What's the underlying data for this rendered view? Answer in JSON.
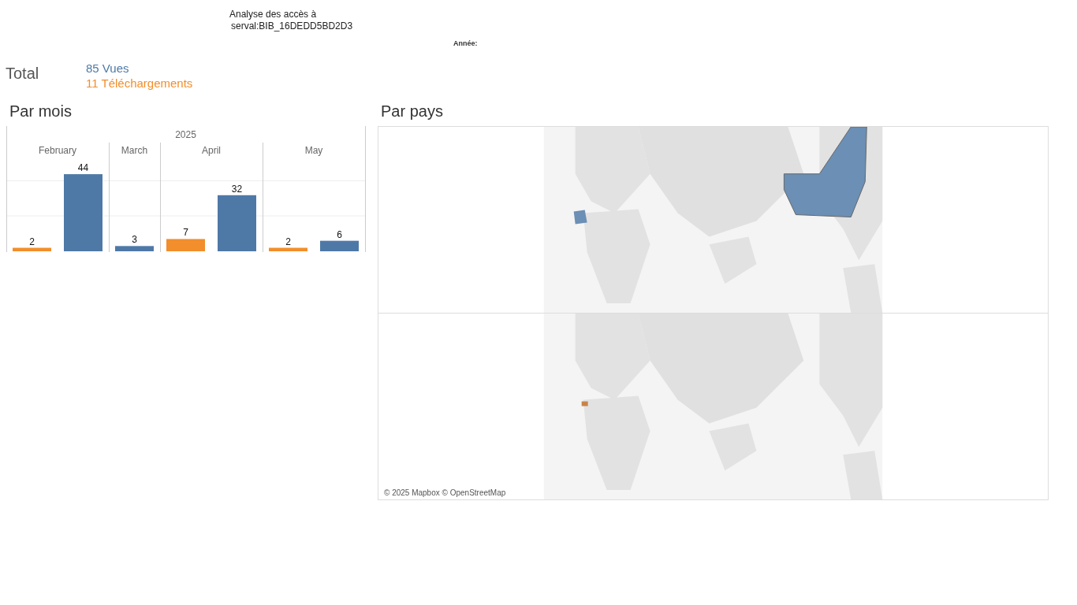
{
  "header": {
    "title_line_1": "Analyse des accès à",
    "title_line_2": "serval:BIB_16DEDD5BD2D3",
    "year_filter_label": "Année:"
  },
  "totals": {
    "label": "Total",
    "views": "85 Vues",
    "downloads": "11 Téléchargements"
  },
  "by_month": {
    "title": "Par mois",
    "year": "2025",
    "chart_data": {
      "type": "bar",
      "categories": [
        "February",
        "March",
        "April",
        "May"
      ],
      "data_labels": true,
      "series": [
        {
          "color": "#f28e2b",
          "values": [
            2,
            null,
            7,
            2
          ]
        },
        {
          "color": "#4e79a7",
          "values": [
            44,
            3,
            32,
            6
          ]
        }
      ]
    }
  },
  "by_country": {
    "title": "Par pays",
    "attribution": "© 2025 Mapbox © OpenStreetMap"
  }
}
